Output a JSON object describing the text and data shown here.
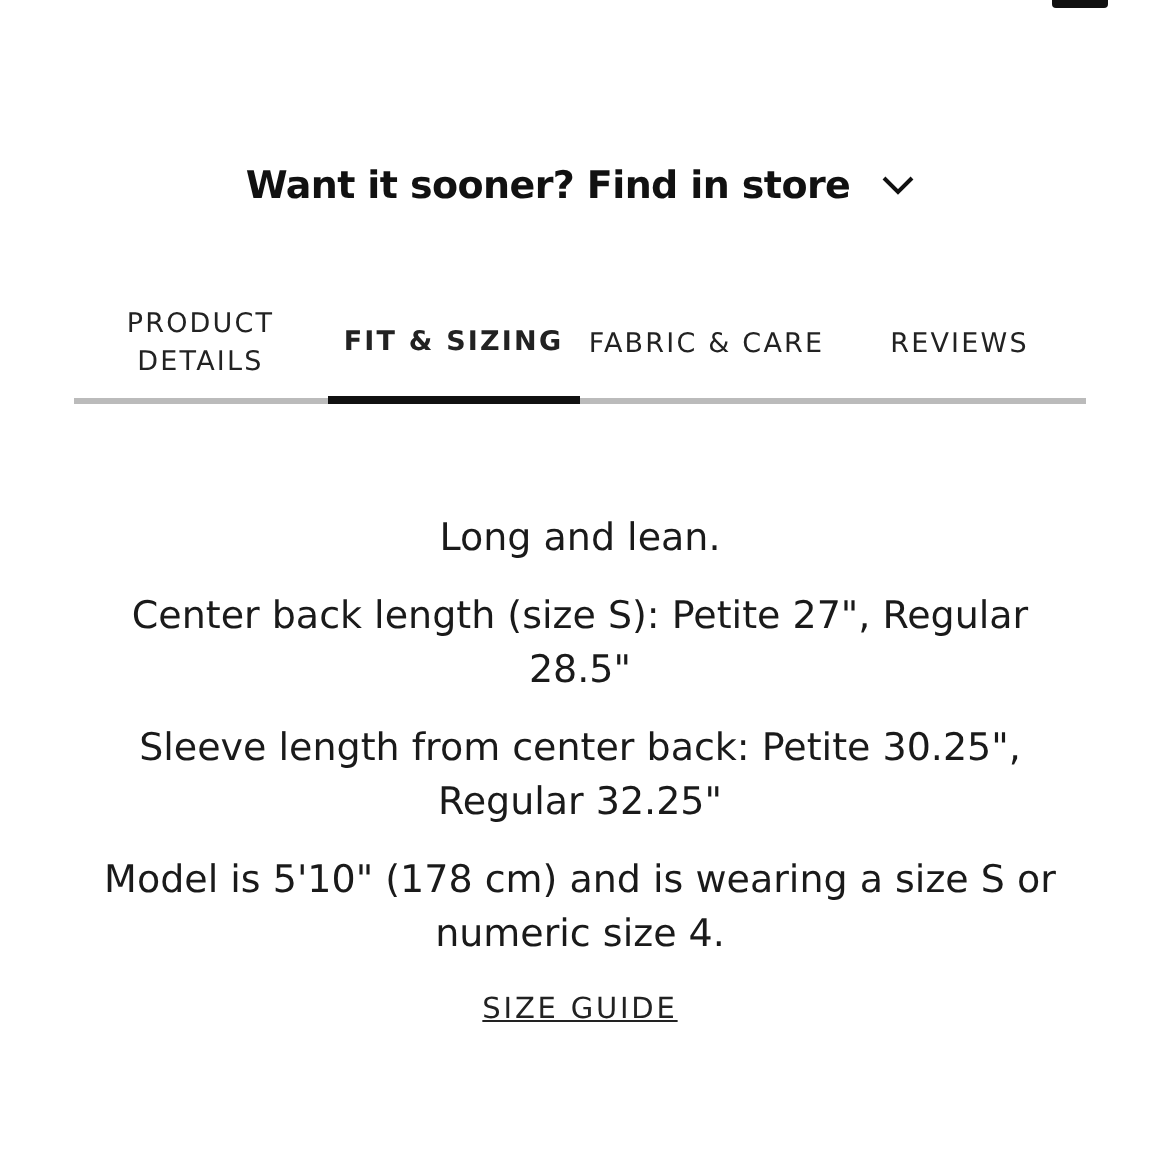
{
  "store_prompt": {
    "label": "Want it sooner? Find in store",
    "expanded": false
  },
  "tabs": [
    {
      "label": "PRODUCT DETAILS",
      "selected": false
    },
    {
      "label": "FIT & SIZING",
      "selected": true
    },
    {
      "label": "FABRIC & CARE",
      "selected": false
    },
    {
      "label": "REVIEWS",
      "selected": false
    }
  ],
  "paragraphs": [
    "Long and lean.",
    "Center back length (size S): Petite 27\", Regular 28.5\"",
    "Sleeve length from center back: Petite 30.25\", Regular 32.25\"",
    "Model is 5'10\" (178 cm) and is wearing a size S or numeric size 4."
  ],
  "size_guide_link": "SIZE GUIDE"
}
